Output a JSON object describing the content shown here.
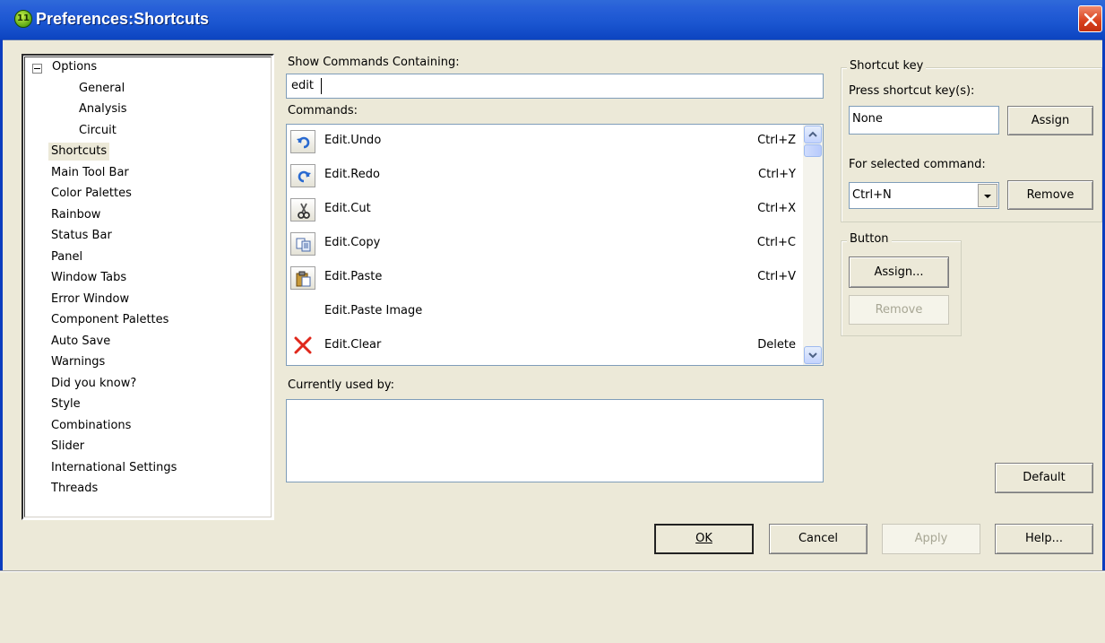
{
  "window": {
    "title": "Preferences:Shortcuts",
    "app_icon_text": "11"
  },
  "tree": {
    "root": "Options",
    "children": [
      "General",
      "Analysis",
      "Circuit"
    ],
    "items": [
      "Shortcuts",
      "Main Tool Bar",
      "Color Palettes",
      "Rainbow",
      "Status Bar",
      "Panel",
      "Window Tabs",
      "Error Window",
      "Component Palettes",
      "Auto Save",
      "Warnings",
      "Did you know?",
      "Style",
      "Combinations",
      "Slider",
      "International Settings",
      "Threads"
    ],
    "selected": "Shortcuts"
  },
  "filter": {
    "label": "Show Commands Containing:",
    "value": "edit"
  },
  "commands": {
    "label": "Commands:",
    "rows": [
      {
        "name": "Edit.Undo",
        "key": "Ctrl+Z",
        "icon": "undo-icon"
      },
      {
        "name": "Edit.Redo",
        "key": "Ctrl+Y",
        "icon": "redo-icon"
      },
      {
        "name": "Edit.Cut",
        "key": "Ctrl+X",
        "icon": "scissors-icon"
      },
      {
        "name": "Edit.Copy",
        "key": "Ctrl+C",
        "icon": "copy-icon"
      },
      {
        "name": "Edit.Paste",
        "key": "Ctrl+V",
        "icon": "paste-icon"
      },
      {
        "name": "Edit.Paste Image",
        "key": "",
        "icon": ""
      },
      {
        "name": "Edit.Clear",
        "key": "Delete",
        "icon": "delete-x-icon"
      }
    ]
  },
  "used_by": {
    "label": "Currently used by:",
    "value": ""
  },
  "shortcut_key": {
    "group_title": "Shortcut key",
    "press_label": "Press shortcut key(s):",
    "press_value": "None",
    "assign_label": "Assign",
    "selected_label": "For selected command:",
    "selected_value": "Ctrl+N",
    "remove_label": "Remove"
  },
  "button_group": {
    "title": "Button",
    "assign_label": "Assign...",
    "remove_label": "Remove"
  },
  "footer": {
    "default_label": "Default",
    "ok_label": "OK",
    "cancel_label": "Cancel",
    "apply_label": "Apply",
    "help_label": "Help..."
  },
  "colors": {
    "titlebar": "#0c44c0",
    "dialog_bg": "#ece9d8",
    "close_red": "#d8401c"
  }
}
